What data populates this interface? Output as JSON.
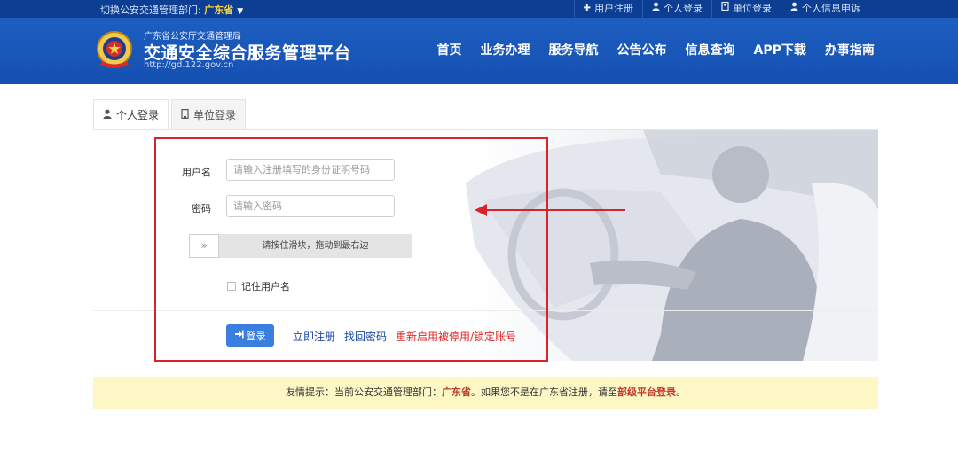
{
  "topbar": {
    "switch_label": "切换公安交通管理部门:",
    "province": "广东省",
    "links": [
      {
        "icon": "plus-icon",
        "label": "用户注册"
      },
      {
        "icon": "user-icon",
        "label": "个人登录"
      },
      {
        "icon": "building-icon",
        "label": "单位登录"
      },
      {
        "icon": "user-icon",
        "label": "个人信息申诉"
      }
    ]
  },
  "header": {
    "org": "广东省公安厅交通管理局",
    "title": "交通安全综合服务管理平台",
    "url": "http://gd.122.gov.cn",
    "nav": [
      "首页",
      "业务办理",
      "服务导航",
      "公告公布",
      "信息查询",
      "APP下载",
      "办事指南"
    ]
  },
  "tabs": [
    {
      "icon": "user-icon",
      "label": "个人登录",
      "active": true
    },
    {
      "icon": "building-icon",
      "label": "单位登录",
      "active": false
    }
  ],
  "form": {
    "username_label": "用户名",
    "username_placeholder": "请输入注册填写的身份证明号码",
    "password_label": "密码",
    "password_placeholder": "请输入密码",
    "slider_handle": "»",
    "slider_text": "请按住滑块，拖动到最右边",
    "remember_label": "记住用户名"
  },
  "actions": {
    "login_label": "登录",
    "register_label": "立即注册",
    "recover_label": "找回密码",
    "reenable_label": "重新启用被停用/锁定账号"
  },
  "notice": {
    "prefix": "友情提示：当前公安交通管理部门：",
    "province": "广东省",
    "middle": "。如果您不是在广东省注册，请至",
    "link": "部级平台登录",
    "suffix": "。"
  },
  "colors": {
    "topbar": "#0c3f94",
    "header": "#1450b1",
    "login_button": "#3a7ee0",
    "annotation_red": "#d8232a",
    "notice_bg": "#fdf7c5"
  }
}
